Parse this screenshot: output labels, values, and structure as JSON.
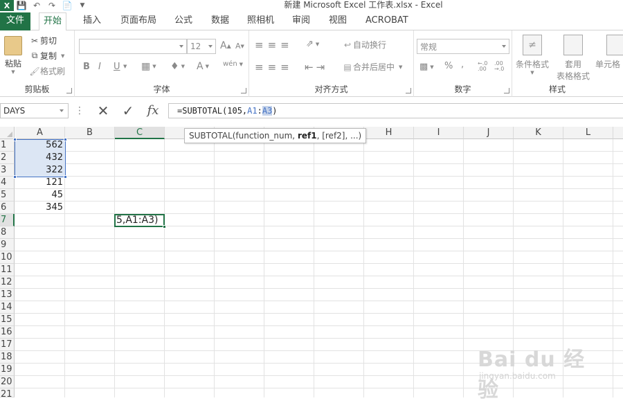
{
  "titlebar": {
    "title": "新建 Microsoft Excel 工作表.xlsx - Excel",
    "app_logo": "X",
    "qat_icons": [
      "save-icon",
      "undo-icon",
      "redo-icon",
      "new-document-icon",
      "customize-icon"
    ]
  },
  "tabs": {
    "file": "文件",
    "items": [
      "开始",
      "插入",
      "页面布局",
      "公式",
      "数据",
      "照相机",
      "审阅",
      "视图",
      "ACROBAT"
    ],
    "active": "开始"
  },
  "ribbon": {
    "clipboard": {
      "label": "剪贴板",
      "paste": "粘贴",
      "cut": "剪切",
      "copy": "复制",
      "format_painter": "格式刷"
    },
    "font": {
      "label": "字体",
      "font_name": "",
      "font_size": "12",
      "bold": "B",
      "italic": "I",
      "underline": "U",
      "grow": "A",
      "shrink": "A",
      "font_color": "A",
      "phonetic": "wén"
    },
    "alignment": {
      "label": "对齐方式",
      "wrap_text": "自动换行",
      "merge_center": "合并后居中"
    },
    "number": {
      "label": "数字",
      "format": "常规",
      "percent": "%",
      "comma": ",",
      "inc_decimal": "←.0 .00",
      "dec_decimal": ".00 →.0"
    },
    "styles": {
      "label": "样式",
      "conditional": "条件格式",
      "format_table_1": "套用",
      "format_table_2": "表格格式",
      "cell_styles": "单元格"
    }
  },
  "formula_bar": {
    "name_box": "DAYS",
    "formula_prefix": "=SUBTOTAL(105,",
    "ref1": "A1",
    "colon": ":",
    "ref2": "A3",
    "formula_suffix": ")"
  },
  "tooltip": {
    "prefix": "SUBTOTAL(function_num, ",
    "bold_arg": "ref1",
    "suffix": ", [ref2], ...)"
  },
  "sheet": {
    "columns": [
      "A",
      "B",
      "C",
      "D",
      "E",
      "F",
      "G",
      "H",
      "I",
      "J",
      "K",
      "L"
    ],
    "active_column": "C",
    "rows": [
      "1",
      "2",
      "3",
      "4",
      "5",
      "6",
      "7",
      "8",
      "9",
      "10",
      "11",
      "12",
      "13",
      "14",
      "15",
      "16",
      "17",
      "18",
      "19",
      "20",
      "21"
    ],
    "active_row": "7",
    "values_a": [
      "562",
      "432",
      "322",
      "121",
      "45",
      "345"
    ],
    "edit_cell_text": "5,A1:A3)"
  },
  "watermark": {
    "text": "Bai du 经验",
    "sub": "jingyan.baidu.com"
  }
}
